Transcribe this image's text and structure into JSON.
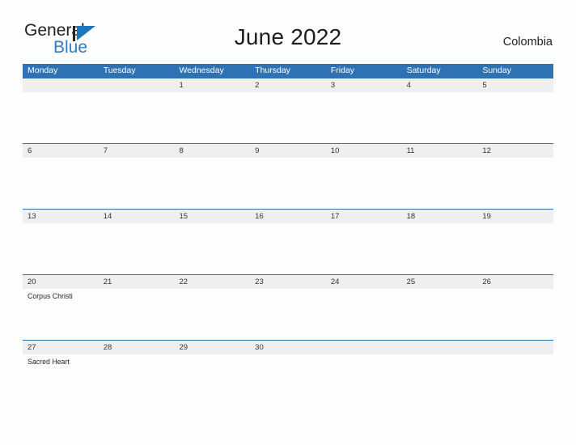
{
  "brand": {
    "name_part1": "General",
    "name_part2": "Blue",
    "flag_icon": "blue-flag-triangle",
    "accent_color": "#2e7cc4"
  },
  "header": {
    "title": "June 2022",
    "country": "Colombia"
  },
  "colors": {
    "header_blue": "#2e72b4",
    "date_band_gray": "#efefef",
    "page_background": "#fdfdfd",
    "text_dark": "#232323"
  },
  "calendar": {
    "month": "June",
    "year": "2022",
    "weekdays": [
      "Monday",
      "Tuesday",
      "Wednesday",
      "Thursday",
      "Friday",
      "Saturday",
      "Sunday"
    ],
    "weeks": [
      [
        {
          "date": "",
          "event": ""
        },
        {
          "date": "",
          "event": ""
        },
        {
          "date": "1",
          "event": ""
        },
        {
          "date": "2",
          "event": ""
        },
        {
          "date": "3",
          "event": ""
        },
        {
          "date": "4",
          "event": ""
        },
        {
          "date": "5",
          "event": ""
        }
      ],
      [
        {
          "date": "6",
          "event": ""
        },
        {
          "date": "7",
          "event": ""
        },
        {
          "date": "8",
          "event": ""
        },
        {
          "date": "9",
          "event": ""
        },
        {
          "date": "10",
          "event": ""
        },
        {
          "date": "11",
          "event": ""
        },
        {
          "date": "12",
          "event": ""
        }
      ],
      [
        {
          "date": "13",
          "event": ""
        },
        {
          "date": "14",
          "event": ""
        },
        {
          "date": "15",
          "event": ""
        },
        {
          "date": "16",
          "event": ""
        },
        {
          "date": "17",
          "event": ""
        },
        {
          "date": "18",
          "event": ""
        },
        {
          "date": "19",
          "event": ""
        }
      ],
      [
        {
          "date": "20",
          "event": "Corpus Christi"
        },
        {
          "date": "21",
          "event": ""
        },
        {
          "date": "22",
          "event": ""
        },
        {
          "date": "23",
          "event": ""
        },
        {
          "date": "24",
          "event": ""
        },
        {
          "date": "25",
          "event": ""
        },
        {
          "date": "26",
          "event": ""
        }
      ],
      [
        {
          "date": "27",
          "event": "Sacred Heart"
        },
        {
          "date": "28",
          "event": ""
        },
        {
          "date": "29",
          "event": ""
        },
        {
          "date": "30",
          "event": ""
        },
        {
          "date": "",
          "event": ""
        },
        {
          "date": "",
          "event": ""
        },
        {
          "date": "",
          "event": ""
        }
      ]
    ]
  }
}
